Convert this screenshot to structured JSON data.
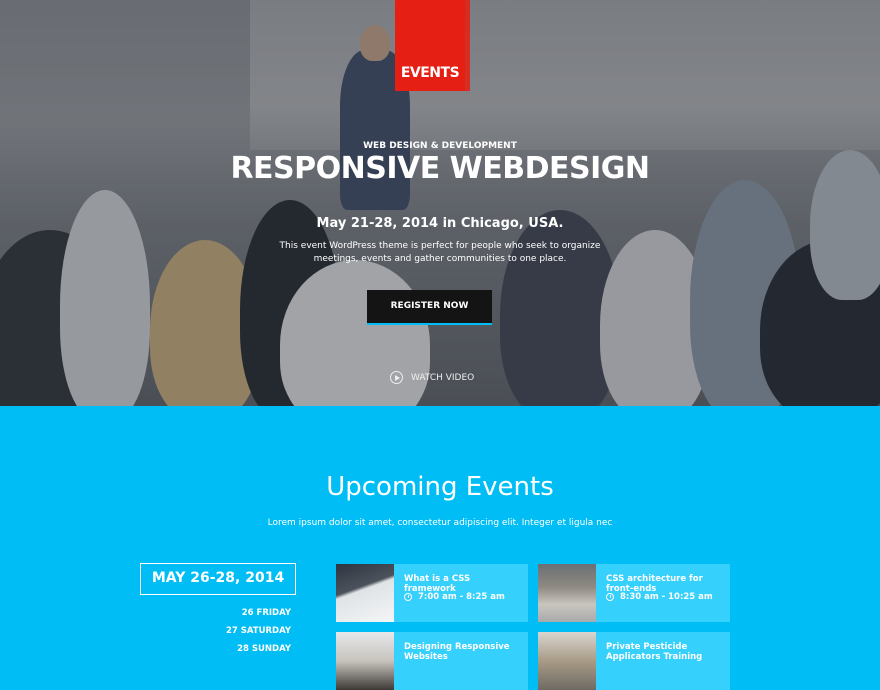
{
  "colors": {
    "brand_red": "#e51f13",
    "accent_blue": "#00bef5",
    "card_blue": "#35d0fb",
    "button_dark": "#141414"
  },
  "logo": {
    "text": "EVENTS"
  },
  "hero": {
    "kicker": "WEB DESIGN & DEVELOPMENT",
    "title": "RESPONSIVE WEBDESIGN",
    "date_location": "May 21-28, 2014 in Chicago, USA.",
    "description": "This event WordPress theme is perfect for people who seek to organize meetings, events and gather communities to one place.",
    "register_label": "REGISTER NOW",
    "watch_label": "WATCH VIDEO",
    "watch_icon": "play-circle-icon"
  },
  "events": {
    "title": "Upcoming Events",
    "subtitle": "Lorem ipsum dolor sit amet, consectetur adipiscing elit. Integer et ligula nec",
    "date_range": "MAY 26-28, 2014",
    "days": [
      "26 FRIDAY",
      "27 SATURDAY",
      "28 SUNDAY"
    ],
    "clock_icon": "clock-icon",
    "cards": [
      {
        "title": "What is a CSS framework",
        "time": "7:00 am - 8:25 am"
      },
      {
        "title": "CSS architecture for front-ends",
        "time": "8:30 am - 10:25 am"
      },
      {
        "title": "Designing Responsive Websites",
        "time": ""
      },
      {
        "title": "Private Pesticide Applicators Training",
        "time": ""
      }
    ]
  }
}
